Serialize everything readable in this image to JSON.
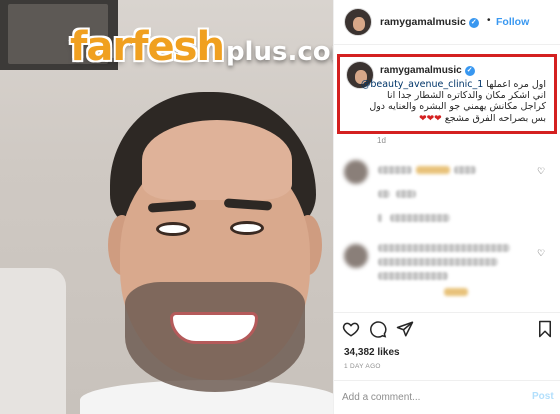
{
  "photo": {
    "watermark": {
      "brand": "farfesh",
      "suffix": "plus.com"
    }
  },
  "header": {
    "username": "ramygamalmusic",
    "verified_icon": "verified-badge-icon",
    "separator": "•",
    "follow_label": "Follow"
  },
  "caption": {
    "username": "ramygamalmusic",
    "line1_text": "اول مره اعملها ",
    "mention": "@beauty_avenue_clinic_1",
    "line2": "اني اشكر مكان والدكاتره الشطار جدا انا",
    "line3": "كراجل مكانش يهمني جو البشره والعنايه دول",
    "line4_text": "بس بصراحه الفرق مشجع ",
    "line4_hearts": "❤❤❤",
    "age": "1d",
    "highlight_color": "#d42020"
  },
  "actions": {
    "icons": [
      "heart-icon",
      "comment-icon",
      "share-icon",
      "bookmark-icon"
    ],
    "likes_count": "34,382",
    "likes_label": "likes",
    "post_age": "1 DAY AGO"
  },
  "comment_box": {
    "placeholder": "Add a comment...",
    "post_label": "Post"
  },
  "colors": {
    "link_blue": "#3897f0",
    "mention_blue": "#003569",
    "watermark_orange": "#f0a020",
    "muted_gray": "#8e8e8e"
  }
}
